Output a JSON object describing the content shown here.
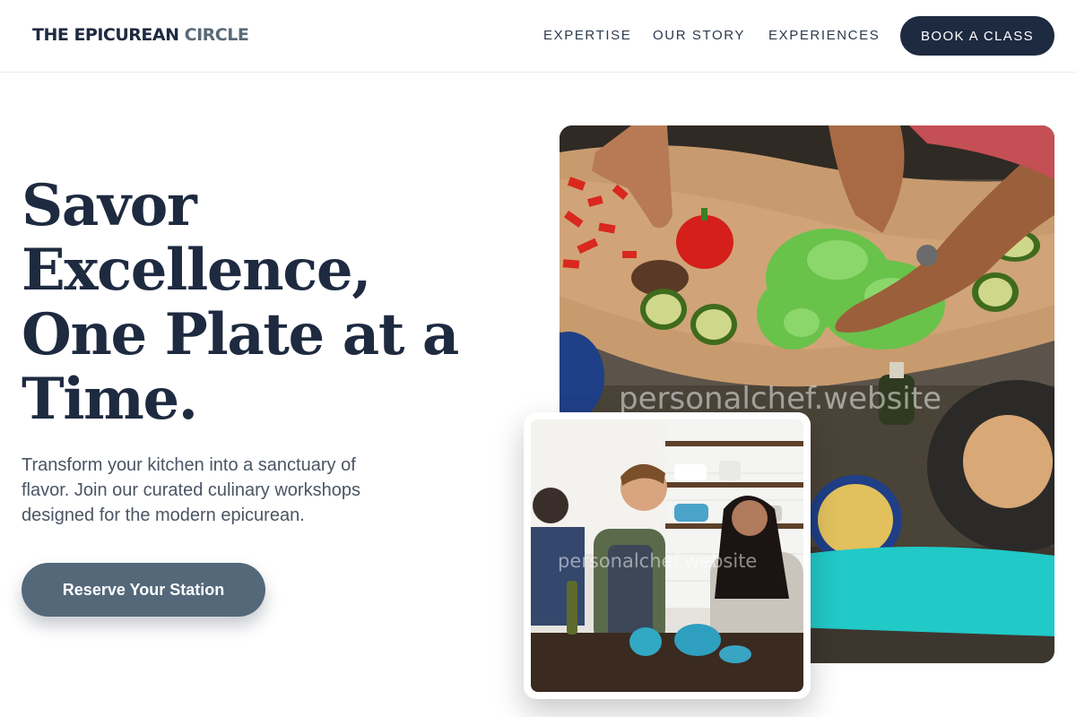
{
  "header": {
    "brand_main": "THE EPICUREAN ",
    "brand_accent": "CIRCLE",
    "nav": [
      "EXPERTISE",
      "OUR STORY",
      "EXPERIENCES"
    ],
    "cta": "BOOK A CLASS"
  },
  "hero": {
    "headline_lines": [
      "Savor",
      "Excellence,",
      "One Plate at a",
      "Time."
    ],
    "subtitle_lines": [
      "Transform your kitchen into a sanctuary of",
      "flavor. Join our curated culinary workshops",
      "designed for the modern epicurean."
    ],
    "button": "Reserve Your Station"
  },
  "images": {
    "main_watermark": "personalchef.website",
    "card_watermark": "personalchef.website"
  },
  "colors": {
    "navy": "#1e2a40",
    "slate_button": "#54687a",
    "brand_accent": "#5a6a78",
    "body_text": "#4b5564"
  }
}
